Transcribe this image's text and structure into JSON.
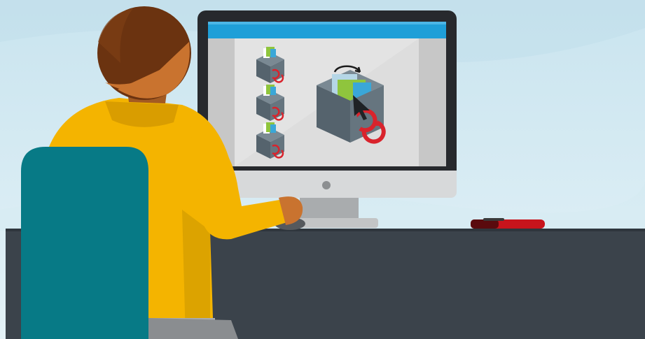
{
  "scene": {
    "kind": "flat illustration",
    "icons": {
      "package_small": "package-icon",
      "package_large": "package-icon",
      "refresh": "refresh-arrows-icon",
      "cursor": "mouse-cursor-icon"
    },
    "colors": {
      "background_top": "#c8e3ee",
      "background_bottom": "#e2f1f6",
      "desk": "#3b434b",
      "monitor_bezel": "#27292d",
      "monitor_chin": "#d7d9da",
      "screen_bg": "#e3e3e3",
      "screen_sidebar": "#c7c7c7",
      "screen_header": "#1f9fd8",
      "chair": "#077a86",
      "sweater": "#f4b400",
      "hair": "#6b3310",
      "skin": "#c9732f",
      "box": "#5e6d77",
      "box_top": "#7a8993",
      "refresh_red": "#d9232c",
      "pen": "#c8141c"
    }
  }
}
